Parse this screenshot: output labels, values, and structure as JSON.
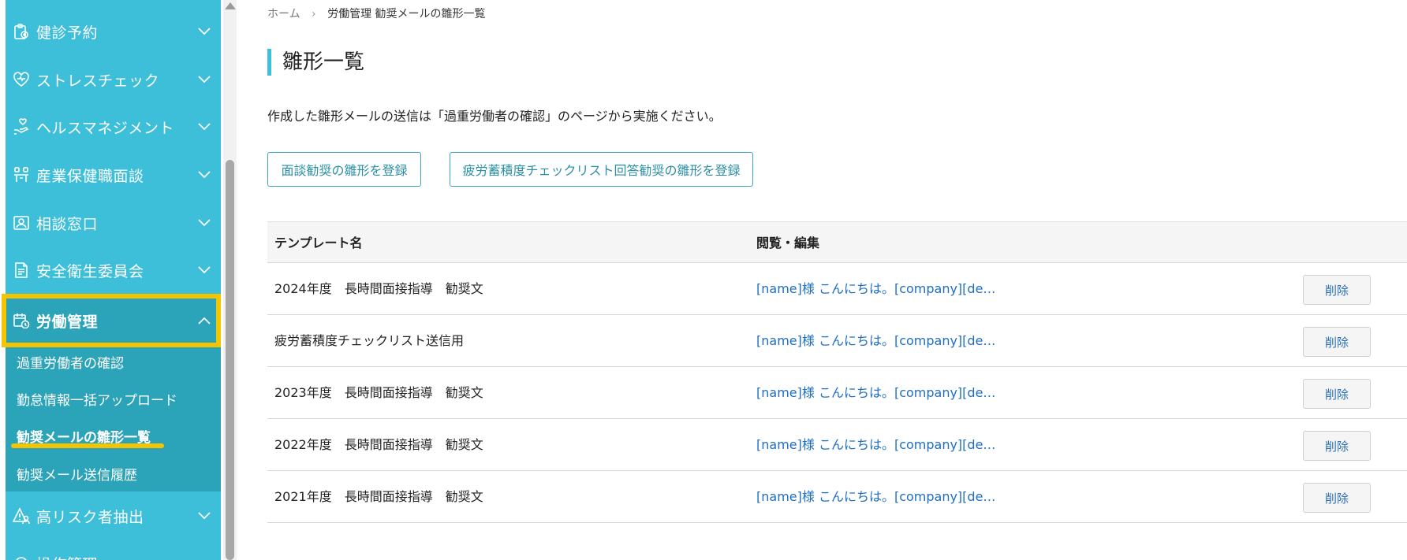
{
  "sidebar": {
    "items": [
      {
        "label": "健診予約",
        "icon": "clipboard-health-icon"
      },
      {
        "label": "ストレスチェック",
        "icon": "heart-icon"
      },
      {
        "label": "ヘルスマネジメント",
        "icon": "hand-heart-icon"
      },
      {
        "label": "産業保健職面談",
        "icon": "people-meeting-icon"
      },
      {
        "label": "相談窓口",
        "icon": "contact-card-icon"
      },
      {
        "label": "安全衛生委員会",
        "icon": "document-icon"
      },
      {
        "label": "労働管理",
        "icon": "calendar-clock-icon"
      },
      {
        "label": "高リスク者抽出",
        "icon": "warning-user-icon"
      },
      {
        "label": "操作管理",
        "icon": "gear-icon"
      }
    ],
    "submenu": [
      {
        "label": "過重労働者の確認"
      },
      {
        "label": "勤怠情報一括アップロード"
      },
      {
        "label": "勧奨メールの雛形一覧"
      },
      {
        "label": "勧奨メール送信履歴"
      }
    ]
  },
  "breadcrumb": {
    "home": "ホーム",
    "separator": "›",
    "current": "労働管理 勧奨メールの雛形一覧"
  },
  "main": {
    "title": "雛形一覧",
    "description": "作成した雛形メールの送信は「過重労働者の確認」のページから実施ください。",
    "buttons": {
      "interview": "面談勧奨の雛形を登録",
      "fatigue": "疲労蓄積度チェックリスト回答勧奨の雛形を登録"
    }
  },
  "table": {
    "headers": {
      "name": "テンプレート名",
      "view": "閲覧・編集"
    },
    "rows": [
      {
        "name": "2024年度　長時間面接指導　勧奨文",
        "preview": "[name]様 こんにちは。[company][de…",
        "delete": "削除"
      },
      {
        "name": "疲労蓄積度チェックリスト送信用",
        "preview": "[name]様 こんにちは。[company][de…",
        "delete": "削除"
      },
      {
        "name": "2023年度　長時間面接指導　勧奨文",
        "preview": "[name]様 こんにちは。[company][de…",
        "delete": "削除"
      },
      {
        "name": "2022年度　長時間面接指導　勧奨文",
        "preview": "[name]様 こんにちは。[company][de…",
        "delete": "削除"
      },
      {
        "name": "2021年度　長時間面接指導　勧奨文",
        "preview": "[name]様 こんにちは。[company][de…",
        "delete": "削除"
      }
    ]
  },
  "colors": {
    "sidebar": "#3ebfd9",
    "sidebar_active": "#2ba4b9",
    "highlight": "#f5c400",
    "link": "#1e6fc4"
  }
}
